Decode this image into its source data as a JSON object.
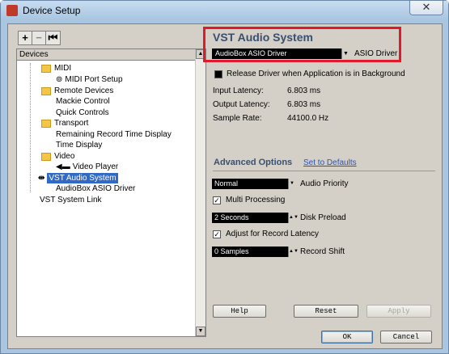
{
  "window": {
    "title": "Device Setup",
    "close_symbol": "✕"
  },
  "toolbar": {
    "add": "+",
    "remove": "−",
    "reset": "⏮"
  },
  "tree": {
    "header": "Devices",
    "items": [
      {
        "label": "MIDI",
        "type": "folder"
      },
      {
        "label": "MIDI Port Setup",
        "type": "item"
      },
      {
        "label": "Remote Devices",
        "type": "folder"
      },
      {
        "label": "Mackie Control",
        "type": "item"
      },
      {
        "label": "Quick Controls",
        "type": "item"
      },
      {
        "label": "Transport",
        "type": "folder"
      },
      {
        "label": "Remaining Record Time Display",
        "type": "item"
      },
      {
        "label": "Time Display",
        "type": "item"
      },
      {
        "label": "Video",
        "type": "folder"
      },
      {
        "label": "Video Player",
        "type": "item"
      },
      {
        "label": "VST Audio System",
        "type": "item"
      },
      {
        "label": "AudioBox ASIO Driver",
        "type": "item"
      },
      {
        "label": "VST System Link",
        "type": "item"
      }
    ]
  },
  "vst": {
    "title": "VST Audio System",
    "driver_value": "AudioBox ASIO Driver",
    "driver_label": "ASIO Driver",
    "release_label": "Release Driver when Application is in Background",
    "input_latency_label": "Input Latency:",
    "input_latency": "6.803 ms",
    "output_latency_label": "Output Latency:",
    "output_latency": "6.803 ms",
    "sample_rate_label": "Sample Rate:",
    "sample_rate": "44100.0 Hz"
  },
  "advanced": {
    "title": "Advanced Options",
    "defaults_link": "Set to Defaults",
    "audio_priority_value": "Normal",
    "audio_priority_label": "Audio Priority",
    "multi_processing_label": "Multi Processing",
    "disk_preload_value": "2 Seconds",
    "disk_preload_label": "Disk Preload",
    "adjust_latency_label": "Adjust for Record Latency",
    "record_shift_value": "0 Samples",
    "record_shift_label": "Record Shift"
  },
  "buttons": {
    "help": "Help",
    "reset": "Reset",
    "apply": "Apply",
    "ok": "OK",
    "cancel": "Cancel"
  },
  "icons": {
    "app": "cubase-icon",
    "folder": "folder-icon",
    "midi": "midi-port-icon",
    "video": "video-player-icon",
    "vst": "vst-audio-icon"
  }
}
